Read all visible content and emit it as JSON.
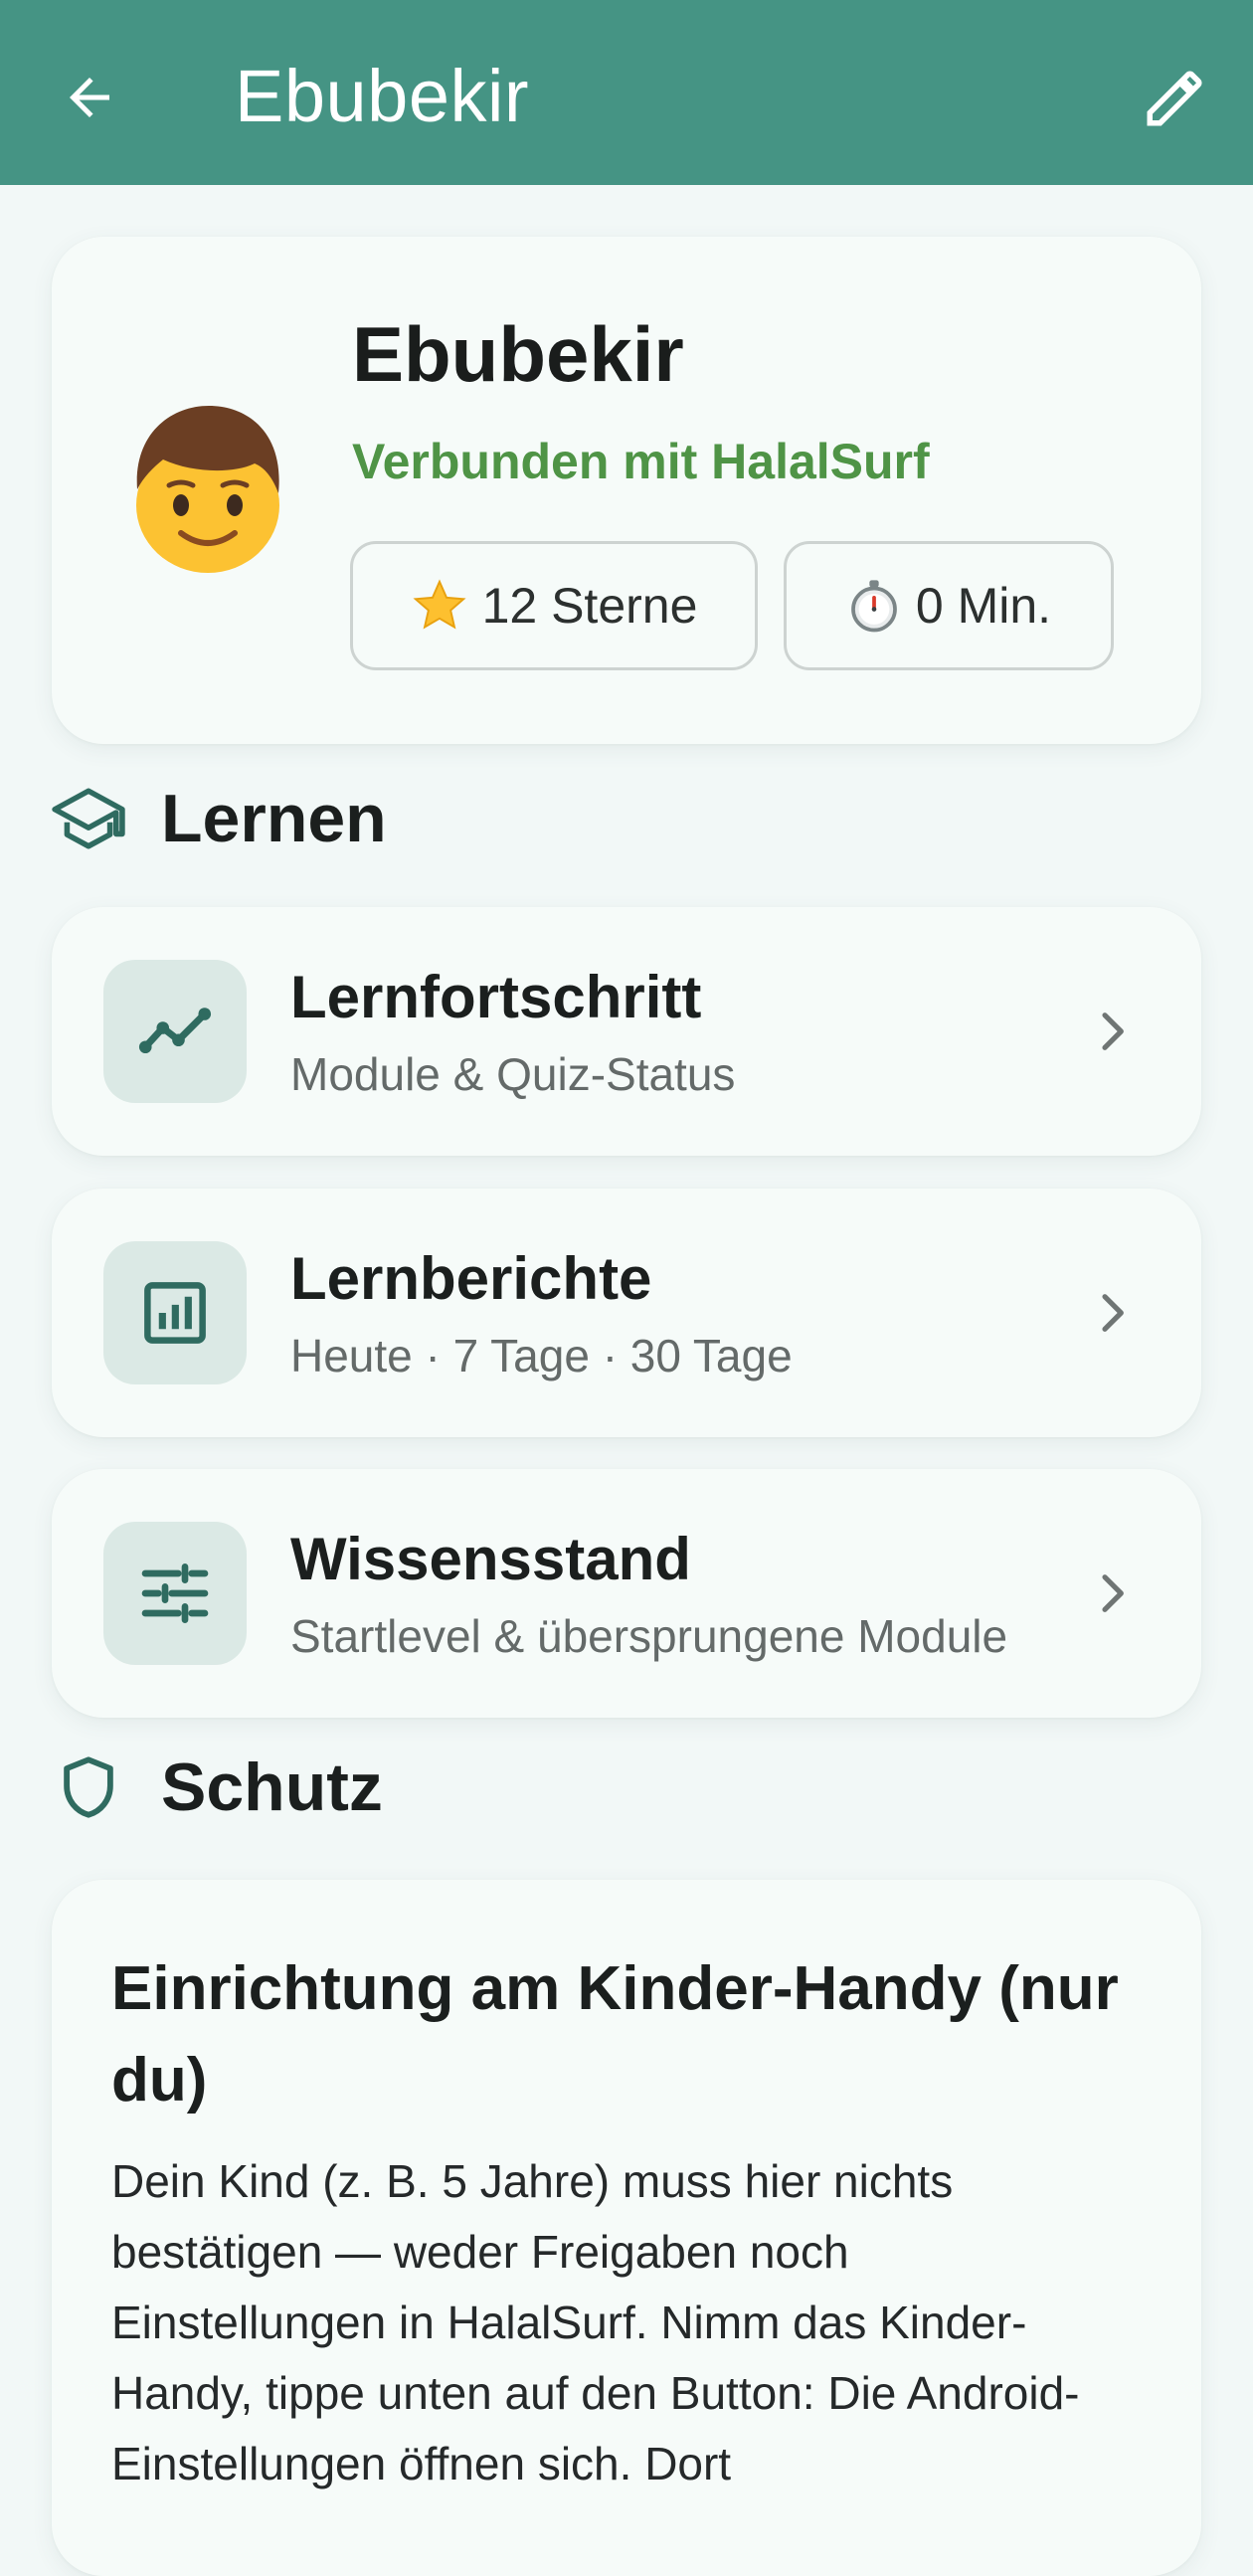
{
  "appbar": {
    "title": "Ebubekir",
    "back_icon": "arrow-back-icon",
    "edit_icon": "pencil-edit-icon",
    "background": "#459484"
  },
  "profile": {
    "avatar_icon": "boy-emoji-icon",
    "name": "Ebubekir",
    "status": "Verbunden mit HalalSurf",
    "status_color": "#4f9446",
    "stars_label": "12 Sterne",
    "stars_icon": "star-emoji-icon",
    "time_label": "0 Min.",
    "time_icon": "stopwatch-emoji-icon"
  },
  "sections": {
    "learn": {
      "label": "Lernen",
      "icon": "graduation-cap-icon"
    },
    "protect": {
      "label": "Schutz",
      "icon": "shield-icon"
    }
  },
  "learn_items": [
    {
      "title": "Lernfortschritt",
      "subtitle": "Module & Quiz-Status",
      "icon": "trend-line-icon"
    },
    {
      "title": "Lernberichte",
      "subtitle": "Heute · 7 Tage · 30 Tage",
      "icon": "bar-chart-icon"
    },
    {
      "title": "Wissensstand",
      "subtitle": "Startlevel & übersprungene Module",
      "icon": "sliders-tune-icon"
    }
  ],
  "setup": {
    "title": "Einrichtung am Kinder-Handy (nur du)",
    "body": "Dein Kind (z. B. 5 Jahre) muss hier nichts bestätigen — weder Freigaben noch Einstellungen in HalalSurf. Nimm das Kinder-Handy, tippe unten auf den Button: Die Android-Einstellungen öffnen sich. Dort"
  },
  "colors": {
    "accent": "#459484",
    "icon_dark": "#2f6b60",
    "tile_bg": "#dbe9e5"
  }
}
